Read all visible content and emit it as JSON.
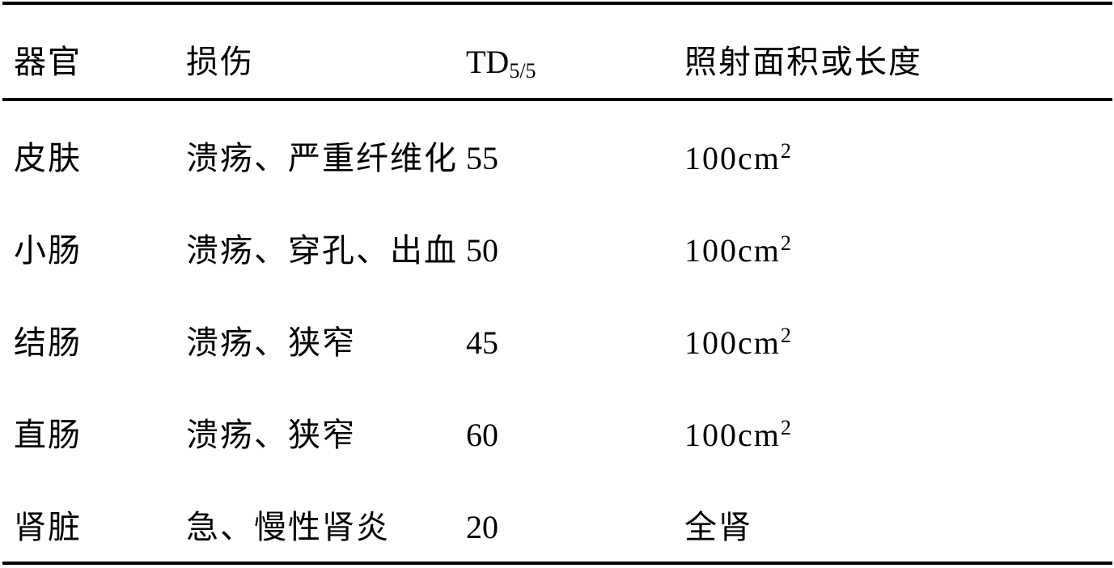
{
  "table": {
    "headers": {
      "organ": "器官",
      "damage": "损伤",
      "td_base": "TD",
      "td_sub": "5/5",
      "area": "照射面积或长度"
    },
    "rows": [
      {
        "organ": "皮肤",
        "damage": "溃疡、严重纤维化",
        "td": "55",
        "area_base": "100cm",
        "area_sup": "2"
      },
      {
        "organ": "小肠",
        "damage": "溃疡、穿孔、出血",
        "td": "50",
        "area_base": "100cm",
        "area_sup": "2"
      },
      {
        "organ": "结肠",
        "damage": "溃疡、狭窄",
        "td": "45",
        "area_base": "100cm",
        "area_sup": "2"
      },
      {
        "organ": "直肠",
        "damage": "溃疡、狭窄",
        "td": "60",
        "area_base": "100cm",
        "area_sup": "2"
      },
      {
        "organ": "肾脏",
        "damage": "急、慢性肾炎",
        "td": "20",
        "area_base": "全肾",
        "area_sup": ""
      }
    ]
  }
}
